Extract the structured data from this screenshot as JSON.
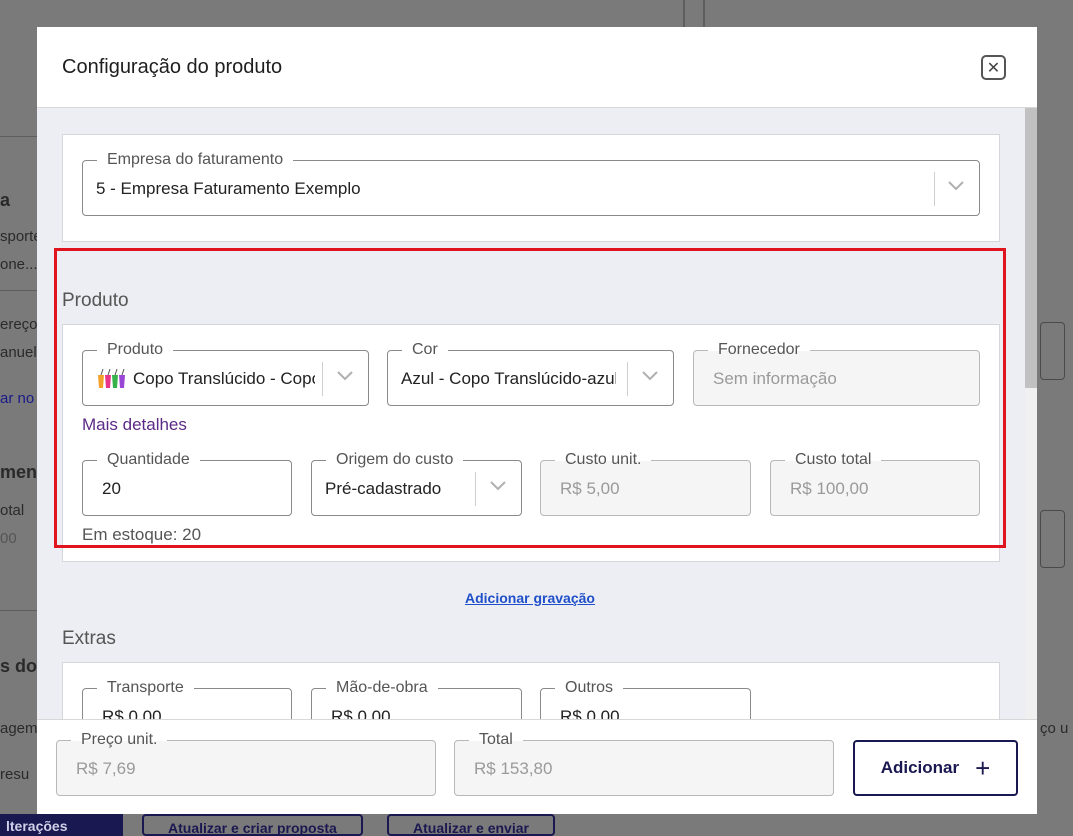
{
  "background": {
    "fragments": [
      "a",
      "sporte",
      "one...",
      "ereço",
      "anuel",
      "ar no",
      "ment",
      "otal",
      "00",
      "s do c",
      "agem",
      "resu",
      "ço u",
      "lterações",
      "Atualizar e criar proposta",
      "Atualizar e enviar"
    ]
  },
  "modal": {
    "title": "Configuração do produto",
    "billing": {
      "label": "Empresa do faturamento",
      "value": "5 - Empresa Faturamento Exemplo"
    },
    "produto_section": {
      "title": "Produto",
      "produto": {
        "label": "Produto",
        "value": "Copo Translúcido - Copo"
      },
      "cor": {
        "label": "Cor",
        "value": "Azul - Copo Translúcido-azul_c"
      },
      "fornecedor": {
        "label": "Fornecedor",
        "value": "Sem informação"
      },
      "more_details": "Mais detalhes",
      "quantidade": {
        "label": "Quantidade",
        "value": "20"
      },
      "origem": {
        "label": "Origem do custo",
        "value": "Pré-cadastrado"
      },
      "custo_unit": {
        "label": "Custo unit.",
        "value": "R$ 5,00"
      },
      "custo_total": {
        "label": "Custo total",
        "value": "R$ 100,00"
      },
      "stock": "Em estoque: 20"
    },
    "add_engraving": "Adicionar gravação",
    "extras": {
      "title": "Extras",
      "transporte": {
        "label": "Transporte",
        "value": "R$ 0,00"
      },
      "mao_de_obra": {
        "label": "Mão-de-obra",
        "value": "R$ 0,00"
      },
      "outros": {
        "label": "Outros",
        "value": "R$ 0,00"
      }
    },
    "footer": {
      "preco_unit": {
        "label": "Preço unit.",
        "value": "R$ 7,69"
      },
      "total": {
        "label": "Total",
        "value": "R$ 153,80"
      },
      "add_button": "Adicionar"
    }
  },
  "colors": {
    "accent_navy": "#1a1850",
    "highlight_red": "#e0141e",
    "link_purple": "#5b2a86",
    "link_blue": "#1f4fc9"
  },
  "icons": [
    "close-icon",
    "chevron-down-icon",
    "cups-icon",
    "plus-icon"
  ]
}
